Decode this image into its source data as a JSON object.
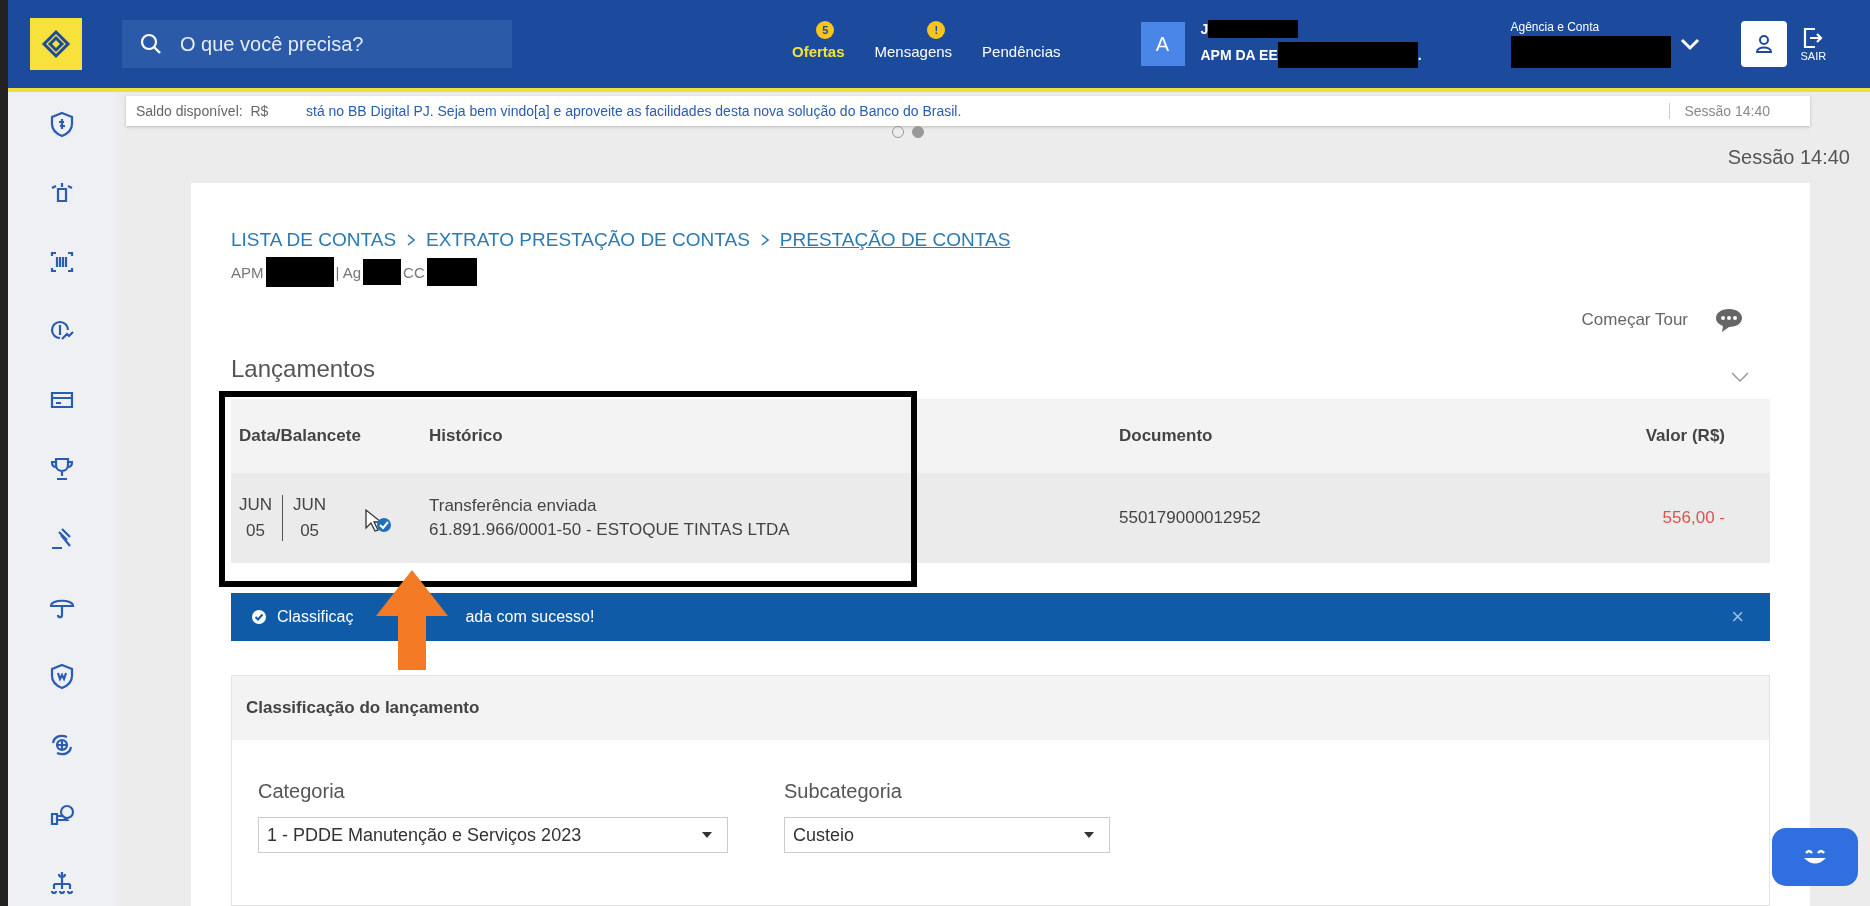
{
  "header": {
    "search": {
      "placeholder": "O que você precisa?"
    },
    "nav": [
      {
        "label": "Ofertas",
        "badge": "5",
        "selected": true
      },
      {
        "label": "Mensagens",
        "badge": "!",
        "selected": false
      },
      {
        "label": "Pendências",
        "selected": false
      }
    ],
    "user": {
      "avatar": "A",
      "name": "J",
      "company": "APM DA EE",
      "company_tail": "."
    },
    "account_label": "Agência e Conta",
    "logout": "SAIR"
  },
  "ticker": {
    "balance": "Saldo disponível:  R$",
    "message": "stá no BB Digital PJ. Seja bem vindo[a] e aproveite as facilidades desta nova solução do Banco do Brasil.",
    "session": "Sessão 14:40",
    "dots": [
      {
        "selected": false
      },
      {
        "selected": true
      }
    ]
  },
  "session": "Sessão 14:40",
  "breadcrumb": [
    {
      "label": "LISTA DE CONTAS",
      "selected": false
    },
    {
      "label": "EXTRATO PRESTAÇÃO DE CONTAS",
      "selected": false
    },
    {
      "label": "PRESTAÇÃO DE CONTAS",
      "selected": true
    }
  ],
  "account_line": [
    "APM",
    "| Ag",
    "CC"
  ],
  "tour": "Começar Tour",
  "section_title": "Lançamentos",
  "table": {
    "columns": [
      "Data/Balancete",
      "Histórico",
      "Documento",
      "Valor (R$)"
    ],
    "rows": [
      {
        "date1": [
          "JUN",
          "05"
        ],
        "date2": [
          "JUN",
          "05"
        ],
        "history": [
          "Transferência enviada",
          "61.891.966/0001-50 - ESTOQUE TINTAS LTDA"
        ],
        "document": "550179000012952",
        "value": "556,00 -"
      }
    ]
  },
  "alert": {
    "text_start": "Classificaç",
    "text_end": "ada com sucesso!",
    "close": "×"
  },
  "classification": {
    "title": "Classificação do lançamento",
    "fields": [
      {
        "label": "Categoria",
        "value": "1 - PDDE Manutenção e Serviços 2023"
      },
      {
        "label": "Subcategoria",
        "value": "Custeio"
      }
    ]
  }
}
